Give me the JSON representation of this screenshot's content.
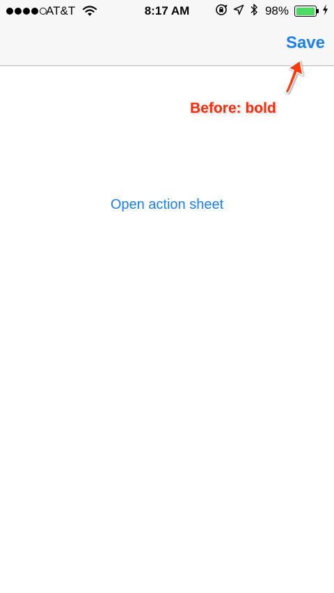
{
  "status_bar": {
    "carrier": "AT&T",
    "time": "8:17 AM",
    "battery_percent": "98%",
    "battery_level": 0.98,
    "signal_bars_filled": 4,
    "signal_bars_total": 5
  },
  "nav_bar": {
    "save_label": "Save"
  },
  "annotation": {
    "label": "Before: bold"
  },
  "content": {
    "open_action_sheet_label": "Open action sheet"
  },
  "colors": {
    "accent": "#1b7ff5",
    "annotation": "#ff2a0a",
    "battery": "#4cd964"
  }
}
